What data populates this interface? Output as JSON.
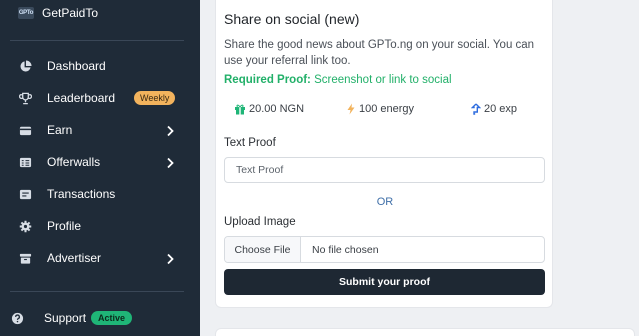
{
  "brand": {
    "logo_text": "GPTo",
    "name": "GetPaidTo"
  },
  "sidebar": {
    "items": [
      {
        "label": "Dashboard",
        "icon": "pie-chart-icon"
      },
      {
        "label": "Leaderboard",
        "icon": "trophy-icon",
        "badge": "Weekly"
      },
      {
        "label": "Earn",
        "icon": "wallet-icon",
        "has_submenu": true
      },
      {
        "label": "Offerwalls",
        "icon": "grid-list-icon",
        "has_submenu": true
      },
      {
        "label": "Transactions",
        "icon": "transactions-icon"
      },
      {
        "label": "Profile",
        "icon": "gear-icon"
      },
      {
        "label": "Advertiser",
        "icon": "box-icon",
        "has_submenu": true
      }
    ],
    "support": {
      "label": "Support",
      "icon": "question-circle-icon",
      "badge": "Active"
    }
  },
  "task": {
    "title": "Share on social (new)",
    "description": "Share the good news about GPTo.ng on your social. You can use your referral link too.",
    "required_label": "Required Proof:",
    "required_value": "Screenshot or link to social",
    "rewards": {
      "money": "20.00 NGN",
      "energy": "100 energy",
      "exp": "20 exp"
    },
    "text_proof_label": "Text Proof",
    "text_proof_placeholder": "Text Proof",
    "or_text": "OR",
    "upload_label": "Upload Image",
    "choose_file_label": "Choose File",
    "no_file_text": "No file chosen",
    "submit_label": "Submit your proof"
  },
  "colors": {
    "sidebar_bg": "#1f2b38",
    "weekly_badge": "#f2b35d",
    "active_badge": "#1fb577",
    "required_green": "#22b069",
    "or_blue": "#3f6fa8",
    "submit_bg": "#1e2833",
    "gift_green": "#1fb577",
    "energy_amber": "#f2b35d",
    "exp_blue": "#2d6cdf"
  }
}
